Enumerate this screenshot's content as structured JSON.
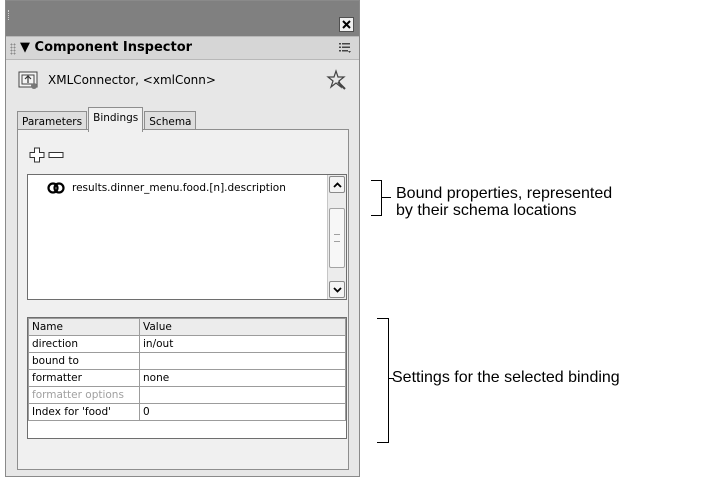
{
  "panel": {
    "title": "Component Inspector",
    "component_label": "XMLConnector, <xmlConn>",
    "tabs": [
      {
        "label": "Parameters",
        "active": false
      },
      {
        "label": "Bindings",
        "active": true
      },
      {
        "label": "Schema",
        "active": false
      }
    ],
    "bindings": [
      {
        "label": "results.dinner_menu.food.[n].description",
        "icon": "binding-icon"
      }
    ],
    "settings": {
      "headers": [
        "Name",
        "Value"
      ],
      "rows": [
        {
          "name": "direction",
          "value": "in/out",
          "disabled": false
        },
        {
          "name": "bound to",
          "value": "",
          "disabled": false
        },
        {
          "name": "formatter",
          "value": "none",
          "disabled": false
        },
        {
          "name": "formatter options",
          "value": "",
          "disabled": true
        },
        {
          "name": "Index for 'food'",
          "value": "0",
          "disabled": false
        }
      ]
    }
  },
  "annotations": {
    "bound_properties_line1": "Bound properties, represented",
    "bound_properties_line2": "by their schema locations",
    "settings_selected": "Settings for the selected binding"
  },
  "icons": [
    "close-icon",
    "collapse-arrow-icon",
    "panel-menu-icon",
    "xml-connector-icon",
    "wizard-icon",
    "add-icon",
    "remove-icon",
    "binding-icon",
    "scroll-up-icon",
    "scroll-down-icon"
  ]
}
